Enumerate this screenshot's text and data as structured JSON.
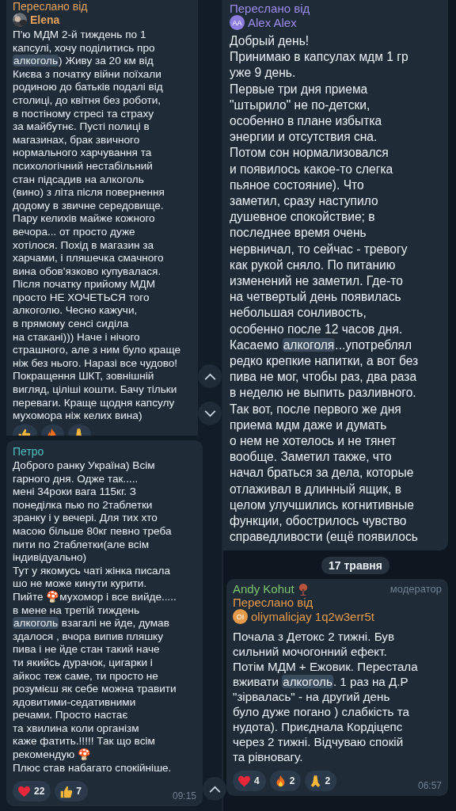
{
  "columns": [
    {
      "tiles": [
        {
          "kind": "message",
          "forwarded_label": "Переслано від",
          "sender": {
            "name": "Elena"
          },
          "body": [
            {
              "text": "П'ю МДМ 2-й тиждень по 1\nкапсулі, хочу поділитись про\n",
              "highlighted": false
            },
            {
              "text": "алкоголь",
              "highlighted": true
            },
            {
              "text": ") Живу за 20 км від\nКиєва з початку війни поїхали\nродиною до батьків подалі від\nстолиці, до квітня без роботи,\nв постіному стресі та страху\nза майбутнє. Пусті полиці в\nмагазинах, брак звичного\nнормального харчування та\nпсихологічний нестабільний\nстан підсадив на алкоголь\n(вино) з літа після повернення\nдодому в звичне середовище.\nПару келихів майже кожного\nвечора... от просто дуже\nхотілося. Похід в магазин за\nхарчами, і пляшечка смачного\nвина обов'язково купувалася.\nПісля початку прийому МДМ\nпросто НЕ ХОЧЕТЬСЯ того\nалкоголю. Чесно кажучи,\nв прямому сенсі сиділа\nна стакані))) Наче і нічого\nстрашного, але з ним було краще\nніж без нього. Наразі все чудово!\nПокращення ШКТ, зовнішній\nвигляд, ціліші кошти. Бачу тільки\nпереваги. Краще щодня капсулу\nмухомора ніж келих вина)",
              "highlighted": false
            }
          ],
          "reactions": [
            {
              "kind": "thumbs"
            },
            {
              "kind": "fire"
            },
            {
              "kind": "pray"
            }
          ]
        },
        {
          "kind": "message",
          "sender": {
            "name": "Петро"
          },
          "body": [
            {
              "text": "Доброго ранку Україна) Всім\nгарного дня. Одже так.....\nмені 34роки вага 115кг. З\nпонеділка пью по 2таблетки\nзранку і у вечері.  Для тих хто\nмасою більше 80кг  певно треба\nпити по 2таблетки(але всім\nіндивідуально)\nТут у якомусь чаті жінка писала\nшо не може кинути курити.\nПийте 🍄мухомор і все вийде.....\nв мене на третій тиждень\n",
              "highlighted": false
            },
            {
              "text": "алкоголь",
              "highlighted": true
            },
            {
              "text": " взагалі не йде, думав\nздалося , вчора випив пляшку\nпива і не йде стан такий наче\nти якийсь дурачок, цигарки і\nайкос теж саме, ти просто не\nрозумієш як себе можна травити\nядовитими-седативними\nречами. Просто настає\nта хвилина коли організм\nкаже фатить.!!!!! Так що всім\nрекомендую 🍄\nПлюс став набагато спокійніше.",
              "highlighted": false
            }
          ],
          "reactions": [
            {
              "kind": "heart",
              "count": "22"
            },
            {
              "kind": "thumbs",
              "count": "7"
            }
          ],
          "time": "09:15"
        }
      ]
    },
    {
      "tiles": [
        {
          "kind": "message",
          "forwarded_label": "Переслано від",
          "sender": {
            "name": "Alex Alex",
            "avatar": {
              "kind": "initials",
              "initials": "AA",
              "color": "#8e7de0"
            }
          },
          "body": [
            {
              "text": "Добрый день!\nПринимаю в капсулах мдм 1 гр\nуже 9 день.\nПервые три дня приема\n\"штырило\" не по-детски,\nособенно в плане избытка\nэнергии и отсутствия сна.\nПотом сон нормализовался\nи появилось какое-то слегка\nпьяное состояние).  Что\nзаметил, сразу наступило\nдушевное спокойствие; в\nпоследнее время очень\nнервничал, то сейчас - тревогу\nкак рукой сняло. По питанию\nизменений не заметил. Где-то\nна четвертый день появилась\nнебольшая сонливость,\nособенно после 12 часов дня.\nКасаемо ",
              "highlighted": false
            },
            {
              "text": "алкоголя",
              "highlighted": true
            },
            {
              "text": "...употреблял\nредко крепкие напитки, а вот без\nпива не мог, чтобы раз, два раза\nв неделю не выпить разливного.\nТак вот, после первого же дня\nприема мдм даже и думать\nо нем не хотелось и не тянет\nвообще. Заметил также, что\nначал браться за дела, которые\nотлаживал в длинный ящик, в\nцелом улучшились когнитивные\nфункции, обострилось чувство\nсправедливости (ещё появилось",
              "highlighted": false
            }
          ]
        },
        {
          "kind": "date",
          "text": "17 травня"
        },
        {
          "kind": "message",
          "sender": {
            "name": "Andy Kohut",
            "role": "модератор"
          },
          "forwarded_label": "Переслано від",
          "forwarded_from": {
            "name": "oliymalicjay 1q2w3err5t",
            "initials": "OI",
            "color": "#e59a4a"
          },
          "body": [
            {
              "text": "Почала з Детокс 2 тижні. Був\nсильний мочогонний ефект.\nПотім МДМ + Ежовик. Перестала\nвживати ",
              "highlighted": false
            },
            {
              "text": "алкоголь",
              "highlighted": true
            },
            {
              "text": ". 1 раз на Д.Р\n\"зірвалась\" - на другий день\nбуло дуже погано ) слабкість та\nнудота). Приєднала Кордіцепс\nчерез 2 тижні. Відчуваю спокій\nта рівновагу.",
              "highlighted": false
            }
          ],
          "reactions": [
            {
              "kind": "heart",
              "count": "4"
            },
            {
              "kind": "fire",
              "count": "2"
            },
            {
              "kind": "pray",
              "count": "2"
            }
          ],
          "time": "06:57"
        }
      ]
    }
  ]
}
